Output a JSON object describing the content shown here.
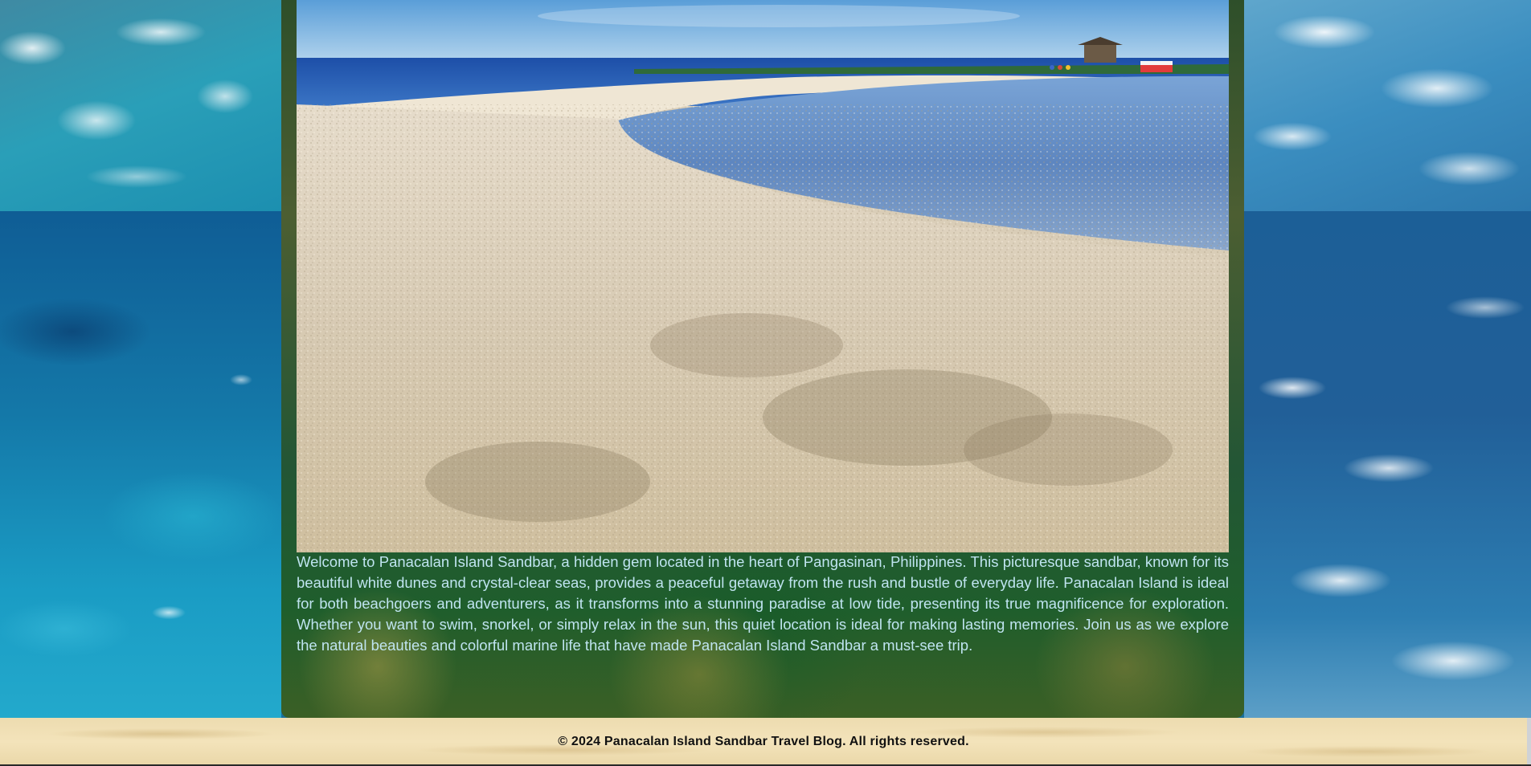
{
  "hero": {
    "alt": "Panacalan Island sandbar with white sand and clear sea"
  },
  "intro": {
    "text": "Welcome to Panacalan Island Sandbar, a hidden gem located in the heart of Pangasinan, Philippines. This picturesque sandbar, known for its beautiful white dunes and crystal-clear seas, provides a peaceful getaway from the rush and bustle of everyday life. Panacalan Island is ideal for both beachgoers and adventurers, as it transforms into a stunning paradise at low tide, presenting its true magnificence for exploration. Whether you want to swim, snorkel, or simply relax in the sun, this quiet location is ideal for making lasting memories. Join us as we explore the natural beauties and colorful marine life that have made Panacalan Island Sandbar a must-see trip."
  },
  "footer": {
    "copyright": "© 2024 Panacalan Island Sandbar Travel Blog. All rights reserved."
  },
  "colors": {
    "intro_text": "#bfe4f0",
    "footer_bg": "#f3e3ba",
    "footer_text": "#111111"
  }
}
